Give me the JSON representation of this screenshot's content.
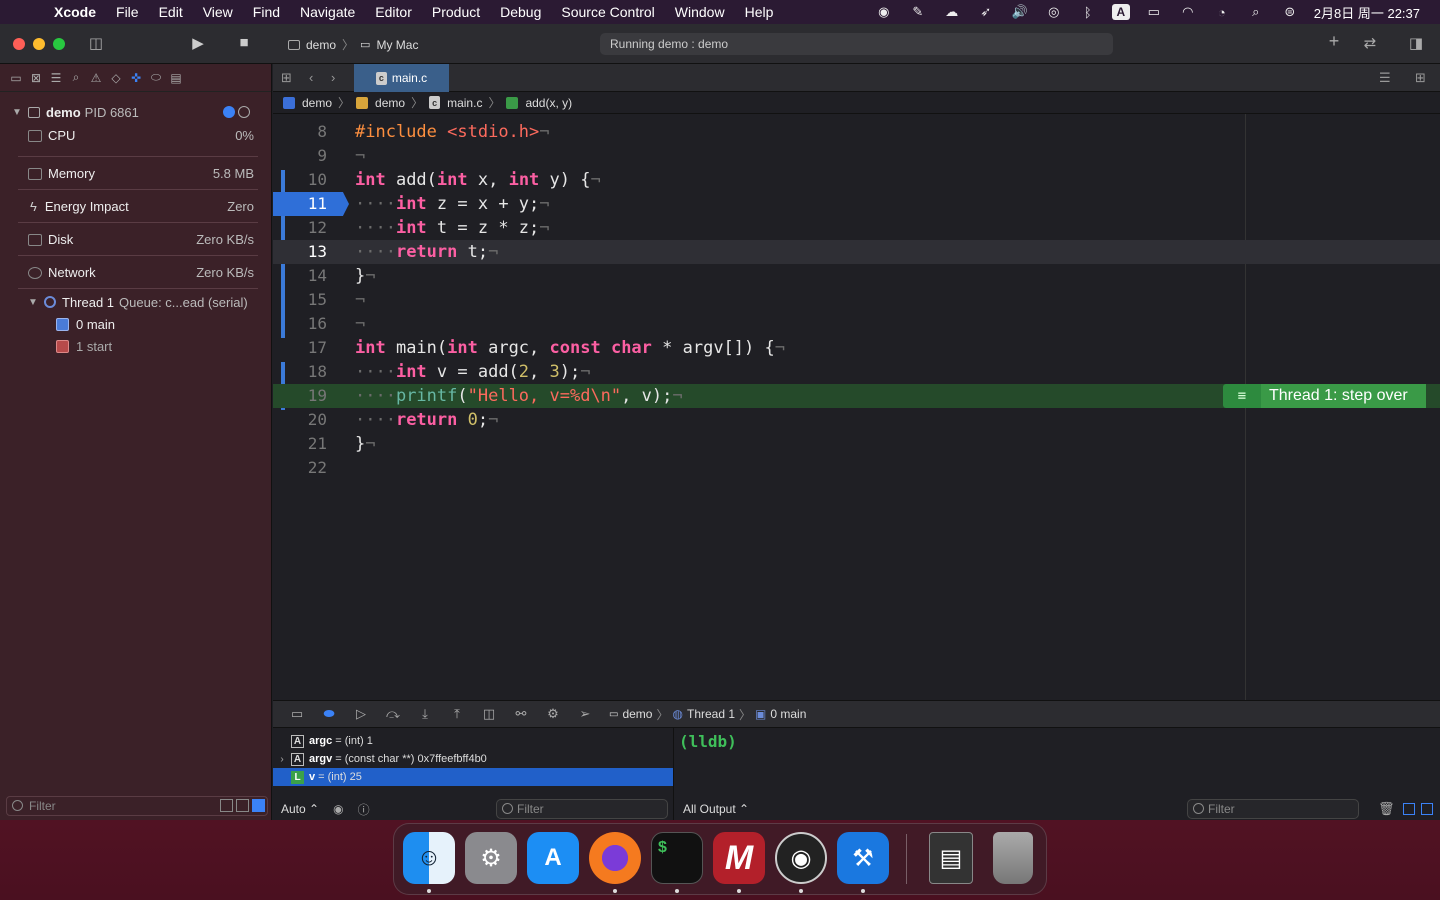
{
  "menubar": {
    "app": "Xcode",
    "items": [
      "File",
      "Edit",
      "View",
      "Find",
      "Navigate",
      "Editor",
      "Product",
      "Debug",
      "Source Control",
      "Window",
      "Help"
    ],
    "clock": "2月8日 周一 22:37",
    "status_icons": [
      "obs-icon",
      "feather-icon",
      "cloud-icon",
      "rocket-icon",
      "volume-icon",
      "airdrop-icon",
      "bluetooth-icon",
      "input-source-icon",
      "battery-icon",
      "wifi-icon",
      "user-icon",
      "spotlight-icon",
      "control-center-icon"
    ],
    "input_source": "A"
  },
  "toolbar": {
    "scheme": "demo",
    "destination": "My Mac",
    "status": "Running demo : demo"
  },
  "navigator": {
    "process": {
      "name": "demo",
      "pid": "PID 6861"
    },
    "gauges": [
      {
        "label": "CPU",
        "value": "0%"
      },
      {
        "label": "Memory",
        "value": "5.8 MB"
      },
      {
        "label": "Energy Impact",
        "value": "Zero"
      },
      {
        "label": "Disk",
        "value": "Zero KB/s"
      },
      {
        "label": "Network",
        "value": "Zero KB/s"
      }
    ],
    "thread": {
      "name": "Thread 1",
      "queue": "Queue: c...ead (serial)"
    },
    "frames": [
      "0 main",
      "1 start"
    ],
    "filter_placeholder": "Filter"
  },
  "editor": {
    "tab": "main.c",
    "jumpbar": [
      "demo",
      "demo",
      "main.c",
      "add(x, y)"
    ],
    "current_line": 13,
    "breakpoint_line": 11,
    "exec_line": 19,
    "thread_label": "Thread 1: step over"
  },
  "debugbar": {
    "crumbs": [
      "demo",
      "Thread 1",
      "0 main"
    ]
  },
  "variables": [
    {
      "badge": "A",
      "name": "argc",
      "value": "= (int) 1",
      "expandable": false,
      "selected": false
    },
    {
      "badge": "A",
      "name": "argv",
      "value": "= (const char **) 0x7ffeefbff4b0",
      "expandable": true,
      "selected": false
    },
    {
      "badge": "L",
      "name": "v",
      "value": "= (int) 25",
      "expandable": false,
      "selected": true
    }
  ],
  "vars_footer": {
    "mode": "Auto ⌃",
    "filter_placeholder": "Filter"
  },
  "console": {
    "prompt": "(lldb)",
    "output_mode": "All Output ⌃",
    "filter_placeholder": "Filter"
  },
  "colors": {
    "breakpoint": "#2f6fd8",
    "exec_line": "#254a2a",
    "thread_label": "#3a9a47",
    "keyword": "#fc5fa3",
    "string": "#fc6a5d",
    "number": "#d0bf69",
    "preprocessor": "#fd8f3f"
  },
  "code": {
    "l8": {
      "n": "8",
      "pp": "#include",
      "sp": " ",
      "st": "<stdio.h>",
      "eol": "¬"
    },
    "l9": {
      "n": "9",
      "eol": "¬"
    },
    "l10": {
      "n": "10",
      "kw1": "int",
      "a": " add(",
      "kw2": "int",
      "b": " x, ",
      "kw3": "int",
      "c": " y) {",
      "eol": "¬"
    },
    "l11": {
      "n": "11",
      "ind": "····",
      "kw": "int",
      "a": " z = x + y;",
      "eol": "¬"
    },
    "l12": {
      "n": "12",
      "ind": "····",
      "kw": "int",
      "a": " t = z * z;",
      "eol": "¬"
    },
    "l13": {
      "n": "13",
      "ind": "····",
      "kw": "return",
      "a": " t;",
      "eol": "¬"
    },
    "l14": {
      "n": "14",
      "a": "}",
      "eol": "¬"
    },
    "l15": {
      "n": "15",
      "eol": "¬"
    },
    "l16": {
      "n": "16",
      "eol": "¬"
    },
    "l17": {
      "n": "17",
      "kw1": "int",
      "a": " main(",
      "kw2": "int",
      "b": " argc, ",
      "kw3": "const",
      "c": " ",
      "kw4": "char",
      "d": " * argv[]) {",
      "eol": "¬"
    },
    "l18": {
      "n": "18",
      "ind": "····",
      "kw": "int",
      "a": " v = add(",
      "n1": "2",
      "b": ", ",
      "n2": "3",
      "c": ");",
      "eol": "¬"
    },
    "l19": {
      "n": "19",
      "ind": "····",
      "fn": "printf",
      "a": "(",
      "st": "\"Hello, v=%d\\n\"",
      "b": ", v);",
      "eol": "¬"
    },
    "l20": {
      "n": "20",
      "ind": "····",
      "kw": "return",
      "a": " ",
      "n1": "0",
      "b": ";",
      "eol": "¬"
    },
    "l21": {
      "n": "21",
      "a": "}",
      "eol": "¬"
    },
    "l22": {
      "n": "22"
    }
  },
  "dock": [
    "finder-icon",
    "system-preferences-icon",
    "app-store-icon",
    "firefox-icon",
    "terminal-icon",
    "matlab-icon",
    "obs-icon",
    "xcode-icon",
    "documents-icon",
    "trash-icon"
  ],
  "dock_glyphs": {
    "terminal": "$",
    "matlab": "M"
  }
}
